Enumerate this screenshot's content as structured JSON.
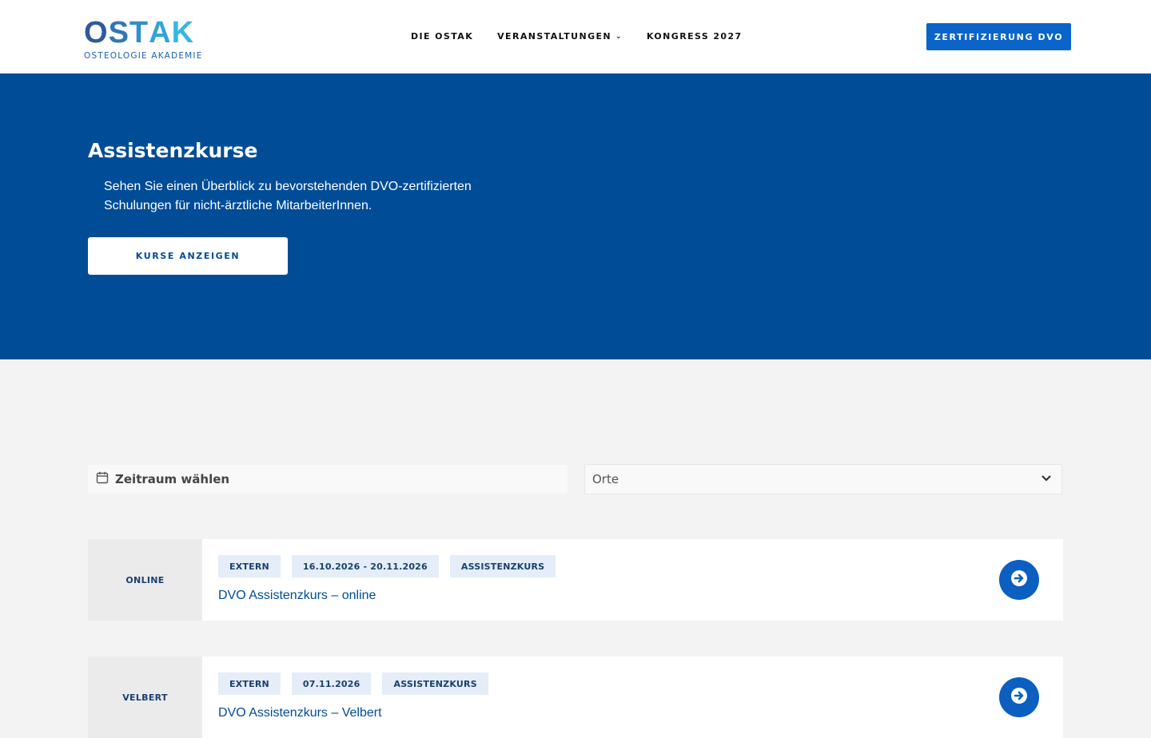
{
  "header": {
    "logo": {
      "word": "OSTAK",
      "subtitle": "OSTEOLOGIE AKADEMIE"
    },
    "nav": [
      {
        "label": "DIE OSTAK"
      },
      {
        "label": "VERANSTALTUNGEN",
        "icon": "chevron-down-icon"
      },
      {
        "label": "KONGRESS 2027"
      }
    ],
    "cta_label": "ZERTIFIZIERUNG DVO"
  },
  "hero": {
    "title": "Assistenzkurse",
    "text": "Sehen Sie einen Überblick zu bevorstehenden DVO-zertifizierten Schulungen für nicht-ärztliche MitarbeiterInnen.",
    "button_label": "KURSE ANZEIGEN"
  },
  "filters": {
    "date_label": "Zeitraum wählen",
    "date_icon": "calendar-icon",
    "location_selected": "Orte",
    "location_icon": "chevron-down-icon"
  },
  "courses": [
    {
      "location": "ONLINE",
      "tags": [
        "EXTERN",
        "16.10.2026 - 20.11.2026",
        "ASSISTENZKURS"
      ],
      "title": "DVO Assistenzkurs – online"
    },
    {
      "location": "VELBERT",
      "tags": [
        "EXTERN",
        "07.11.2026",
        "ASSISTENZKURS"
      ],
      "title": "DVO Assistenzkurs – Velbert"
    }
  ],
  "colors": {
    "brand_blue": "#004c97",
    "accent_blue": "#0a64c9",
    "logo_gradient_start": "#2f5a9e",
    "logo_gradient_end": "#35b6e8",
    "tag_bg": "#e4edf8"
  }
}
